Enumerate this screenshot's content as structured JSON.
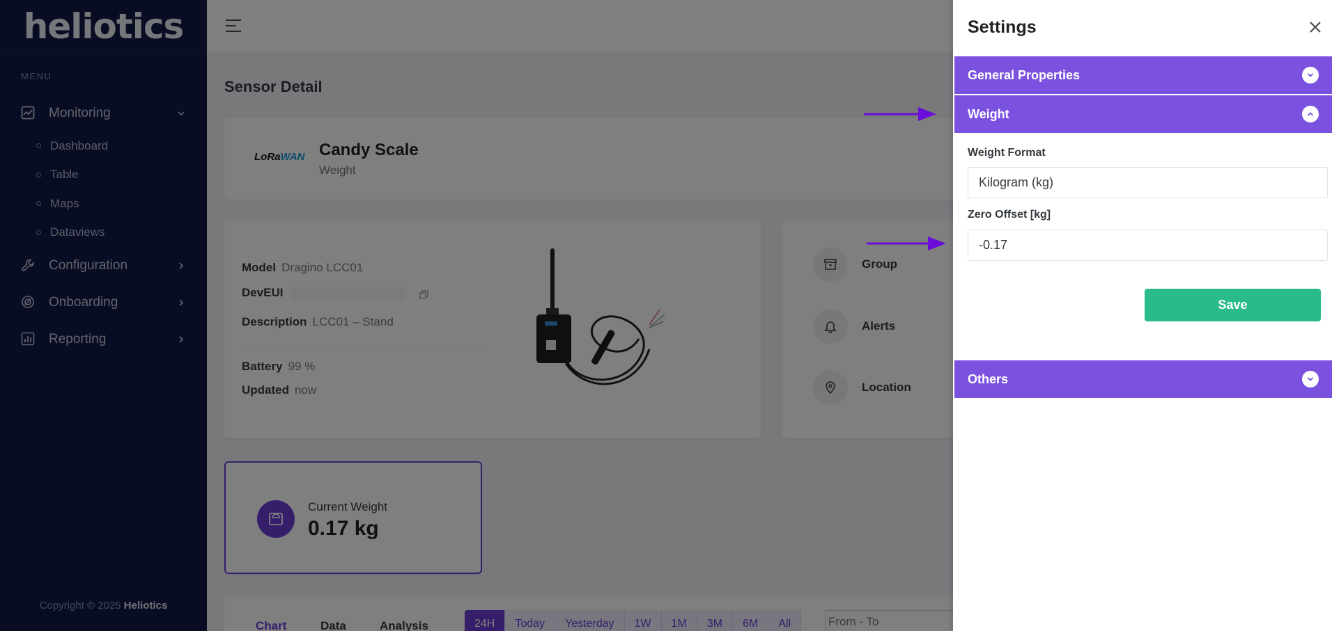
{
  "app": {
    "logo": "heliotics"
  },
  "sidebar": {
    "menu_title": "MENU",
    "items": [
      {
        "label": "Monitoring",
        "icon": "chart-line-icon",
        "expanded": true,
        "children": [
          "Dashboard",
          "Table",
          "Maps",
          "Dataviews"
        ]
      },
      {
        "label": "Configuration",
        "icon": "wrench-icon"
      },
      {
        "label": "Onboarding",
        "icon": "onboarding-icon"
      },
      {
        "label": "Reporting",
        "icon": "report-icon"
      }
    ],
    "copyright_prefix": "Copyright © 2025",
    "copyright_brand": "Heliotics"
  },
  "page": {
    "title": "Sensor Detail",
    "sensor": {
      "logo_text_1": "LoRa",
      "logo_text_2": "WAN",
      "name": "Candy Scale",
      "type": "Weight"
    },
    "info": {
      "model_label": "Model",
      "model_value": "Dragino LCC01",
      "deveui_label": "DevEUI",
      "description_label": "Description",
      "description_value": "LCC01 – Stand",
      "battery_label": "Battery",
      "battery_value": "99 %",
      "updated_label": "Updated",
      "updated_value": "now"
    },
    "actions": [
      "Group",
      "Alerts",
      "Location"
    ],
    "weight": {
      "label": "Current Weight",
      "value": "0.17 kg"
    },
    "tabs": [
      "Chart",
      "Data",
      "Analysis"
    ],
    "ranges": [
      "24H",
      "Today",
      "Yesterday",
      "1W",
      "1M",
      "3M",
      "6M",
      "All"
    ],
    "date_placeholder": "From - To"
  },
  "settings": {
    "title": "Settings",
    "sections": {
      "general": "General Properties",
      "weight": "Weight",
      "others": "Others"
    },
    "weight_format_label": "Weight Format",
    "weight_format_value": "Kilogram (kg)",
    "zero_offset_label": "Zero Offset [kg]",
    "zero_offset_value": "-0.17",
    "save_label": "Save"
  },
  "colors": {
    "sidebar": "#121b47",
    "accent": "#7b52e0",
    "save": "#2abb8c",
    "arrow": "#6a0dd8"
  }
}
